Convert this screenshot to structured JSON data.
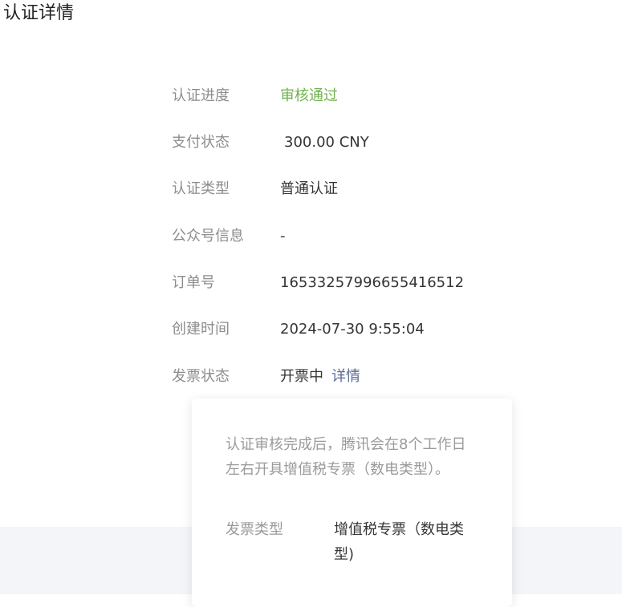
{
  "page": {
    "title": "认证详情"
  },
  "details": {
    "progress": {
      "label": "认证进度",
      "value": "审核通过"
    },
    "payment": {
      "label": "支付状态",
      "value": "300.00 CNY"
    },
    "type": {
      "label": "认证类型",
      "value": "普通认证"
    },
    "account_info": {
      "label": "公众号信息",
      "value": "-"
    },
    "order_no": {
      "label": "订单号",
      "value": "16533257996655416512"
    },
    "created_time": {
      "label": "创建时间",
      "value": "2024-07-30 9:55:04"
    },
    "invoice": {
      "label": "发票状态",
      "value": "开票中",
      "link": "详情"
    }
  },
  "popover": {
    "description": "认证审核完成后，腾讯会在8个工作日左右开具增值税专票（数电类型）。",
    "invoice_type_label": "发票类型",
    "invoice_type_value": "增值税专票（数电类型)"
  },
  "colors": {
    "success": "#6fb24e",
    "link": "#576b95",
    "label": "#8d8d8d",
    "text": "#353535",
    "band": "#f4f5f8"
  }
}
